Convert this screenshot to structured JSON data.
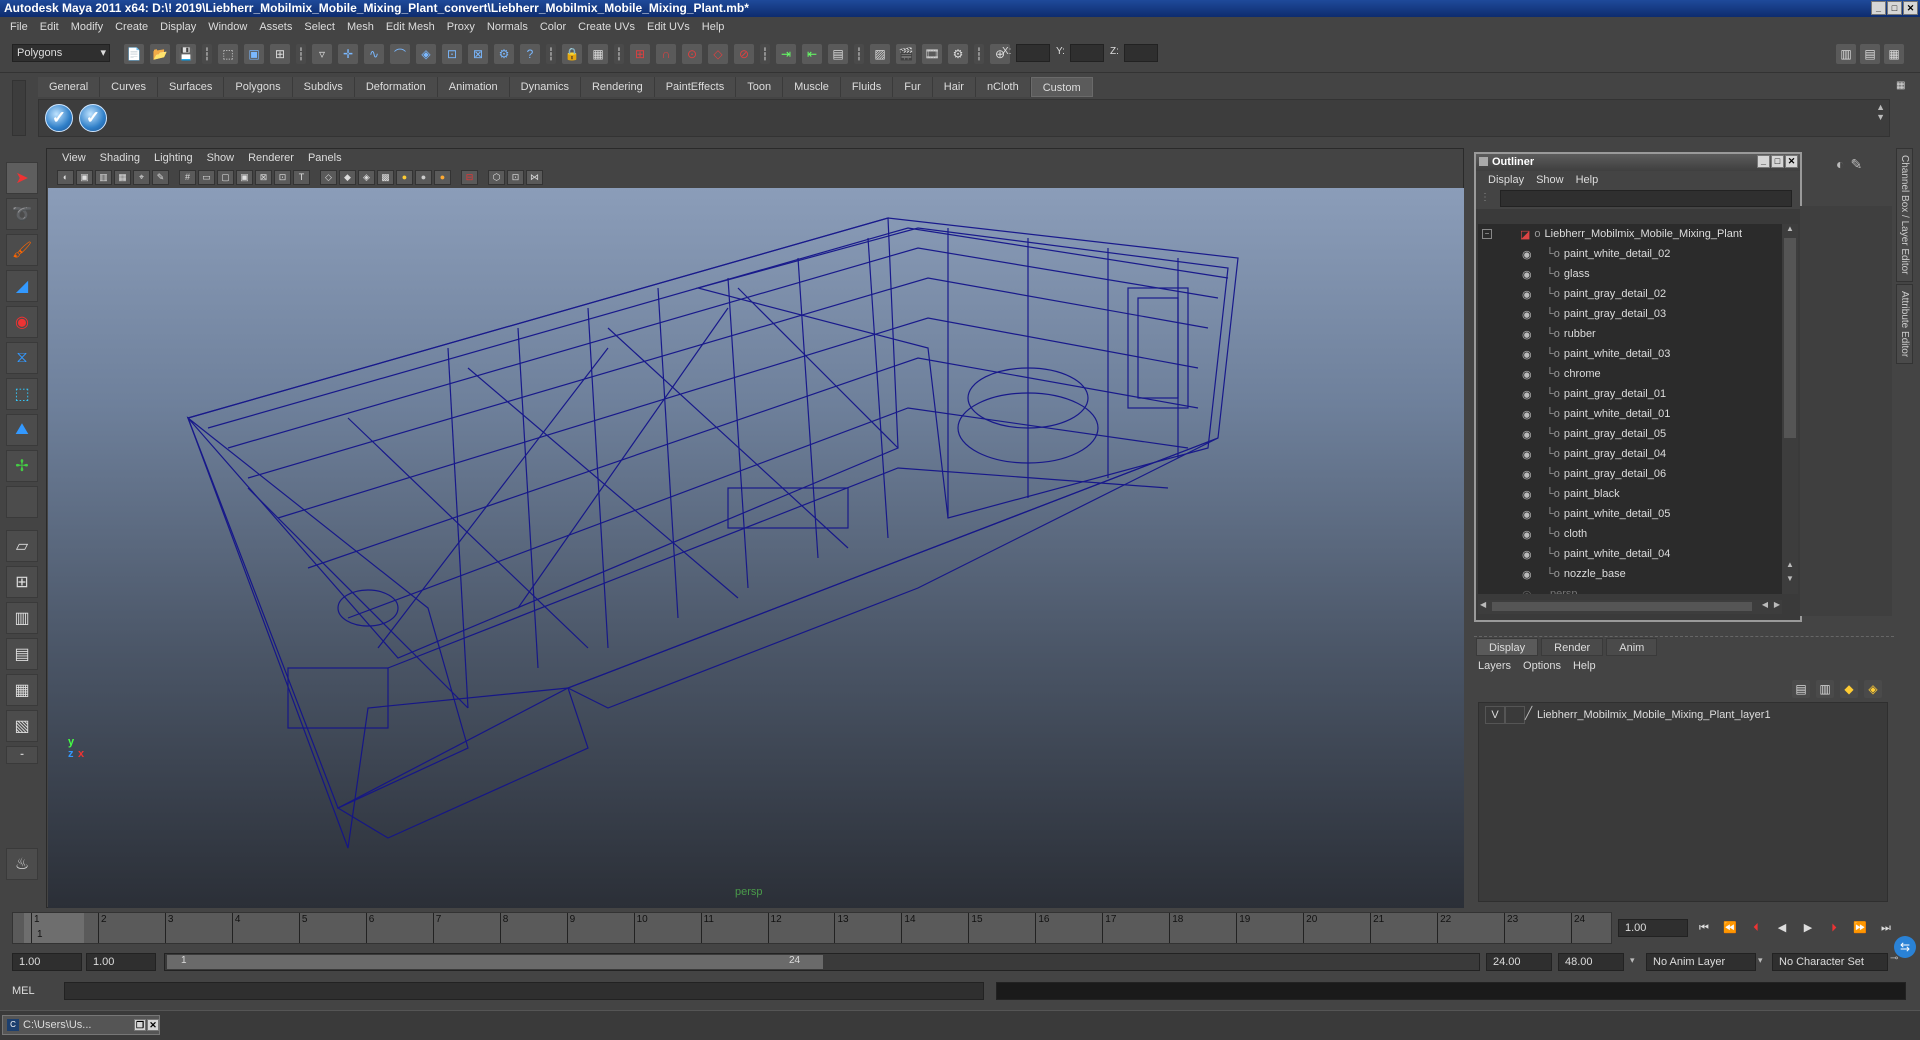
{
  "window": {
    "title": "Autodesk Maya 2011 x64: D:\\! 2019\\Liebherr_Mobilmix_Mobile_Mixing_Plant_convert\\Liebherr_Mobilmix_Mobile_Mixing_Plant.mb*"
  },
  "menubar": [
    "File",
    "Edit",
    "Modify",
    "Create",
    "Display",
    "Window",
    "Assets",
    "Select",
    "Mesh",
    "Edit Mesh",
    "Proxy",
    "Normals",
    "Color",
    "Create UVs",
    "Edit UVs",
    "Help"
  ],
  "statusline": {
    "mode": "Polygons",
    "x_label": "X:",
    "y_label": "Y:",
    "z_label": "Z:"
  },
  "shelf_tabs": [
    "General",
    "Curves",
    "Surfaces",
    "Polygons",
    "Subdivs",
    "Deformation",
    "Animation",
    "Dynamics",
    "Rendering",
    "PaintEffects",
    "Toon",
    "Muscle",
    "Fluids",
    "Fur",
    "Hair",
    "nCloth",
    "Custom"
  ],
  "shelf_active": "Custom",
  "viewport": {
    "menu": [
      "View",
      "Shading",
      "Lighting",
      "Show",
      "Renderer",
      "Panels"
    ],
    "camera_label": "persp",
    "axis_y": "y",
    "axis_x": "x",
    "axis_z": "z"
  },
  "outliner": {
    "title": "Outliner",
    "menu": [
      "Display",
      "Show",
      "Help"
    ],
    "root": "Liebherr_Mobilmix_Mobile_Mixing_Plant",
    "items": [
      "paint_white_detail_02",
      "glass",
      "paint_gray_detail_02",
      "paint_gray_detail_03",
      "rubber",
      "paint_white_detail_03",
      "chrome",
      "paint_gray_detail_01",
      "paint_white_detail_01",
      "paint_gray_detail_05",
      "paint_gray_detail_04",
      "paint_gray_detail_06",
      "paint_black",
      "paint_white_detail_05",
      "cloth",
      "paint_white_detail_04",
      "nozzle_base"
    ],
    "partial": "persp"
  },
  "layer_editor": {
    "tabs": [
      "Display",
      "Render",
      "Anim"
    ],
    "menu": [
      "Layers",
      "Options",
      "Help"
    ],
    "layer_visible": "V",
    "layer_name": "Liebherr_Mobilmix_Mobile_Mixing_Plant_layer1"
  },
  "side_tabs": [
    "Channel Box / Layer Editor",
    "Attribute Editor"
  ],
  "timeline": {
    "ticks": [
      "1",
      "2",
      "3",
      "4",
      "5",
      "6",
      "7",
      "8",
      "9",
      "10",
      "11",
      "12",
      "13",
      "14",
      "15",
      "16",
      "17",
      "18",
      "19",
      "20",
      "21",
      "22",
      "23",
      "24"
    ],
    "current_frame": "1",
    "current_time_field": "1.00"
  },
  "range": {
    "start_field": "1.00",
    "playback_start": "1.00",
    "slider_start": "1",
    "slider_end": "24",
    "playback_end": "24.00",
    "end_field": "48.00",
    "anim_layer": "No Anim Layer",
    "character_set": "No Character Set"
  },
  "command_line": {
    "label": "MEL"
  },
  "taskbar": {
    "item": "C:\\Users\\Us..."
  }
}
